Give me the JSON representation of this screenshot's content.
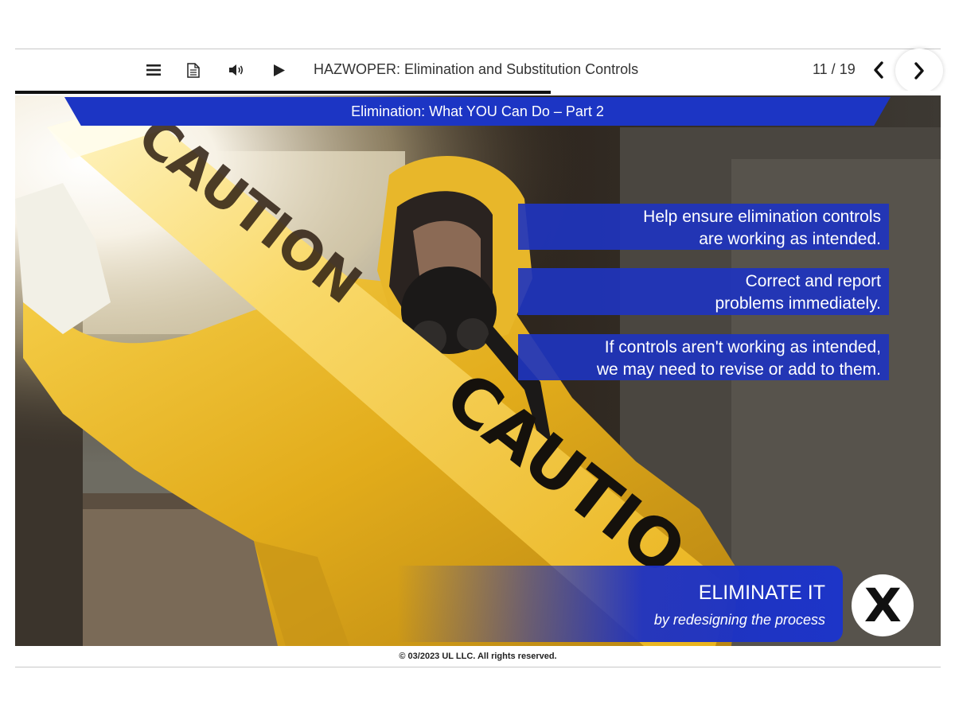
{
  "toolbar": {
    "menu_icon": "menu-icon",
    "transcript_icon": "document-icon",
    "audio_icon": "speaker-icon",
    "play_icon": "play-icon",
    "title": "HAZWOPER: Elimination and Substitution Controls",
    "page_counter": "11 / 19",
    "prev_icon": "chevron-left-icon",
    "next_icon": "chevron-right-icon",
    "progress": 0.579
  },
  "slide": {
    "banner": "Elimination: What YOU Can Do – Part 2",
    "bullets": [
      {
        "line1": "Help ensure elimination controls",
        "line2": "are working as intended."
      },
      {
        "line1": "Correct and report",
        "line2": "problems immediately."
      },
      {
        "line1": "If controls aren't working as intended,",
        "line2": "we may need to revise or add to them."
      }
    ],
    "callout": {
      "title": "ELIMINATE IT",
      "subtitle": "by redesigning the process",
      "badge": "X"
    },
    "photo_text": [
      "CAUTION",
      "CAUTIO"
    ]
  },
  "footer": {
    "copyright": "© 03/2023 UL LLC. All rights reserved."
  },
  "colors": {
    "accent_blue": "#1c35c4",
    "toolbar_text": "#333333",
    "hazmat_yellow": "#e8b420"
  }
}
